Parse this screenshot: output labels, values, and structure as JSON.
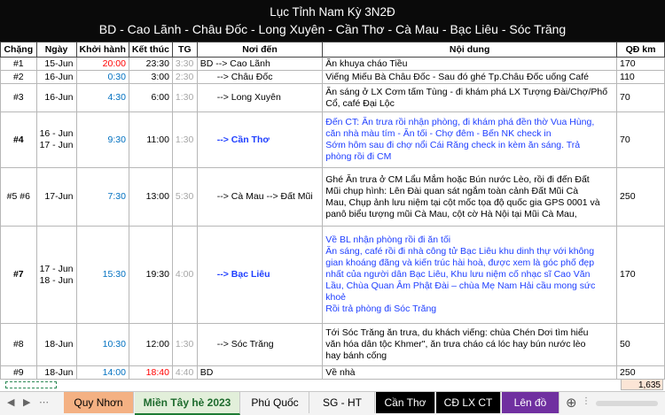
{
  "title": {
    "line1": "Lục Tỉnh Nam Kỳ 3N2Đ",
    "line2": "BD - Cao Lãnh - Châu Đốc - Long Xuyên - Cần Thơ - Cà Mau - Bạc Liêu - Sóc Trăng"
  },
  "headers": {
    "chang": "Chặng",
    "ngay": "Ngày",
    "khoihanh": "Khởi hành",
    "ketthuc": "Kết thúc",
    "tg": "TG",
    "noiden": "Nơi đến",
    "noidung": "Nội dung",
    "qd": "QĐ km"
  },
  "rows": [
    {
      "chang": "#1",
      "ngay": [
        "15-Jun"
      ],
      "khoihanh": "20:00",
      "ketthuc": "23:30",
      "tg": "3:30",
      "noiden": "BD --> Cao Lãnh",
      "noidung": [
        "Ăn khuya cháo Tiều"
      ],
      "qd": "170"
    },
    {
      "chang": "#2",
      "ngay": [
        "16-Jun"
      ],
      "khoihanh": "0:30",
      "ketthuc": "3:00",
      "tg": "2:30",
      "noiden": "--> Châu Đốc",
      "noidung": [
        "Viếng Miếu Bà Châu Đốc - Sau đó ghé Tp.Châu Đốc uống Café"
      ],
      "qd": "110"
    },
    {
      "chang": "#3",
      "ngay": [
        "16-Jun"
      ],
      "khoihanh": "4:30",
      "ketthuc": "6:00",
      "tg": "1:30",
      "noiden": "--> Long Xuyên",
      "noidung": [
        "Ăn sáng ở LX Cơm tấm Tùng  - đi khám phá LX Tượng Đài/Chợ/Phố",
        "Cổ, café Đại Lộc"
      ],
      "qd": "70"
    },
    {
      "chang": "#4",
      "ngay": [
        "16 - Jun",
        "17 - Jun"
      ],
      "khoihanh": "9:30",
      "ketthuc": "11:00",
      "tg": "1:30",
      "noiden": "--> Cần Thơ",
      "noidung": [
        "Đến CT: Ăn trưa rồi nhận phòng, đi khám phá đền thờ Vua Hùng,",
        "căn nhà màu tím - Ăn tối - Chợ đêm - Bến NK check in",
        "Sớm hôm sau đi chợ nổi Cái Răng check in kèm ăn sáng. Trả",
        "phòng rồi đi CM"
      ],
      "qd": "70"
    },
    {
      "chang": "#5 #6",
      "ngay": [
        "17-Jun"
      ],
      "khoihanh": "7:30",
      "ketthuc": "13:00",
      "tg": "5:30",
      "noiden": "--> Cà Mau --> Đất Mũi",
      "noidung": [
        "Ghé Ăn trưa ở CM Lẩu Mắm hoặc Bún nước Lèo, rồi đi đến Đất",
        "Mũi chụp hình: Lên Đài quan sát ngắm toàn cảnh Đất Mũi Cà",
        "Mau, Chụp ảnh lưu niệm tại cột mốc tọa độ quốc gia GPS 0001 và",
        "panô biểu tượng mũi Cà Mau, cột cờ Hà Nội tại Mũi Cà Mau,"
      ],
      "qd": "250"
    },
    {
      "chang": "#7",
      "ngay": [
        "17 - Jun",
        "18 - Jun"
      ],
      "khoihanh": "15:30",
      "ketthuc": "19:30",
      "tg": "4:00",
      "noiden": "--> Bạc Liêu",
      "noidung": [
        "Về BL nhận phòng rồi đi ăn tối",
        "Ăn sáng, café rồi đi nhà công tử Bạc Liêu khu dinh thự với không",
        "gian khoáng đãng và kiến trúc hài hoà, được xem là góc phố đẹp",
        "nhất của người dân Bạc Liêu, Khu lưu niệm cố nhạc sĩ Cao Văn",
        "Lầu, Chùa Quan Âm Phật Đài – chùa Mẹ Nam Hải cầu mong sức",
        "khoẻ",
        "Rồi trả phòng đi Sóc Trăng"
      ],
      "qd": "170"
    },
    {
      "chang": "#8",
      "ngay": [
        "18-Jun"
      ],
      "khoihanh": "10:30",
      "ketthuc": "12:00",
      "tg": "1:30",
      "noiden": "--> Sóc Trăng",
      "noidung": [
        "Tới Sóc Trăng ăn trưa, du khách viếng: chùa Chén Dơi tìm hiểu",
        "văn hóa dân tộc Khmer\", ăn trưa cháo cá lóc hay bún nước lèo",
        "hay bánh cống"
      ],
      "qd": "50"
    },
    {
      "chang": "#9",
      "ngay": [
        "18-Jun"
      ],
      "khoihanh": "14:00",
      "ketthuc": "18:40",
      "tg": "4:40",
      "noiden": "BD",
      "noidung": [
        "Về nhà"
      ],
      "qd": "250"
    }
  ],
  "total_km": "1,635",
  "tabs": [
    {
      "label": "Quy Nhơn"
    },
    {
      "label": "Miền Tây hè 2023"
    },
    {
      "label": "Phú Quốc"
    },
    {
      "label": "SG - HT"
    },
    {
      "label": "Cần Thơ"
    },
    {
      "label": "CĐ LX CT"
    },
    {
      "label": "Lên đồ"
    }
  ],
  "colors": {
    "title_bg": "#0a0a0a",
    "depart_blue": "#0070c0",
    "text_blue": "#1f3fff",
    "red": "#ff0000",
    "tab_quy_nhon": "#f4b183",
    "tab_active": "#e2efda",
    "tab_dark": "#000000",
    "tab_len_do": "#7030a0"
  }
}
